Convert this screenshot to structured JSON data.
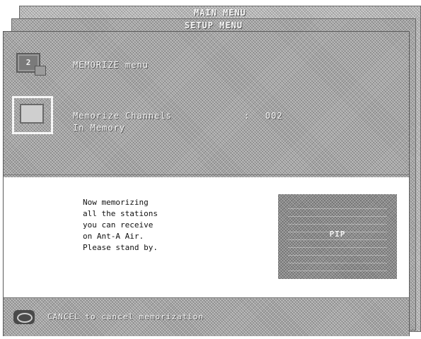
{
  "main_menu": {
    "title": "MAIN MENU"
  },
  "setup_menu": {
    "title": "SETUP MENU"
  },
  "memorize": {
    "menu_icon_glyph": "2",
    "menu_label": "MEMORIZE menu",
    "channels_label": "Memorize Channels",
    "separator": ":",
    "channel_count": "002",
    "in_memory_label": "In Memory"
  },
  "message": {
    "text": "Now memorizing\nall the stations\nyou can receive\non Ant-A Air.\nPlease stand by."
  },
  "pip": {
    "label": "PIP"
  },
  "footer": {
    "cancel_hint": "CANCEL to cancel memorization"
  },
  "icons": {
    "menu_icon": "tv-menu-icon",
    "channel_icon": "tv-screen-icon",
    "cancel_icon": "remote-button-icon"
  },
  "colors": {
    "panel_grey": "#a4a4a4",
    "text_light": "#f4f4f4",
    "message_bg": "#ffffff"
  }
}
